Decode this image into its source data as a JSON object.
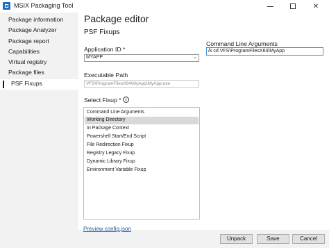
{
  "window": {
    "title": "MSIX Packaging Tool"
  },
  "sidebar": {
    "items": [
      {
        "label": "Package information",
        "active": false
      },
      {
        "label": "Package Analyzer",
        "active": false
      },
      {
        "label": "Package report",
        "active": false
      },
      {
        "label": "Capabilities",
        "active": false
      },
      {
        "label": "Virtual registry",
        "active": false
      },
      {
        "label": "Package files",
        "active": false
      },
      {
        "label": "PSF Fixups",
        "active": true
      }
    ]
  },
  "main": {
    "title": "Package editor",
    "subtitle": "PSF Fixups",
    "application_id": {
      "label": "Application ID *",
      "value": "MYAPP"
    },
    "executable_path": {
      "label": "Executable Path",
      "value": "VFS\\ProgramFilesX64\\MyApp\\MyApp.exe"
    },
    "select_fixup": {
      "label": "Select Fixup *",
      "items": [
        "Command Line Arguments",
        "Working Directory",
        "In Package Context",
        "Powershell Start/End Script",
        "File Redirection Fixup",
        "Registry Legacy Fixup",
        "Dynamic Library Fixup",
        "Environment Variable Fixup"
      ],
      "selected_index": 1
    },
    "preview_link": "Preview config.json"
  },
  "right_panel": {
    "label": "Command Line Arguments",
    "value": "/k cd VFS\\ProgramFilesX64\\MyApp"
  },
  "footer": {
    "unpack_label": "Unpack",
    "save_label": "Save",
    "cancel_label": "Cancel"
  },
  "icons": {
    "app": "msix-app-icon",
    "info": "info-icon",
    "dropdown": "chevron-down-icon"
  },
  "colors": {
    "accent": "#1f6fbf",
    "link": "#1a5ea8",
    "sidebar_bg": "#f2f2f2",
    "selected_item": "#d9d9d9"
  }
}
